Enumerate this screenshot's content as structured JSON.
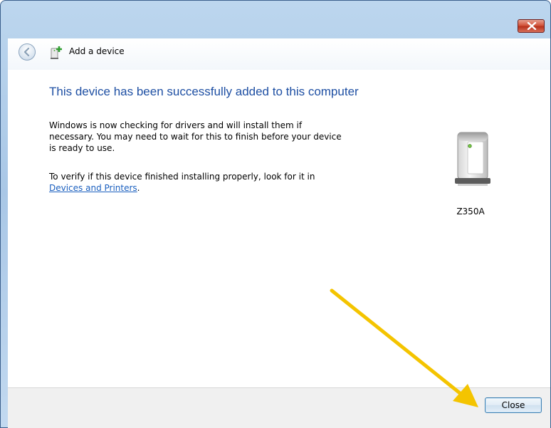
{
  "window": {
    "nav_title": "Add a device",
    "close_icon": "close-x-icon",
    "accent": "#1e4fa3"
  },
  "content": {
    "heading": "This device has been successfully added to this computer",
    "para1_lines": [
      "Windows is now checking for drivers and will install them if",
      "necessary. You may need to wait for this to finish before your device",
      "is ready to use."
    ],
    "para2_line1": "To verify if this device finished installing properly, look for it in",
    "para2_link": "Devices and Printers",
    "para2_suffix": ".",
    "device": {
      "icon": "printer-icon",
      "label": "Z350A"
    }
  },
  "footer": {
    "close_label": "Close"
  },
  "annotation": {
    "arrow_color": "#f4c400"
  }
}
